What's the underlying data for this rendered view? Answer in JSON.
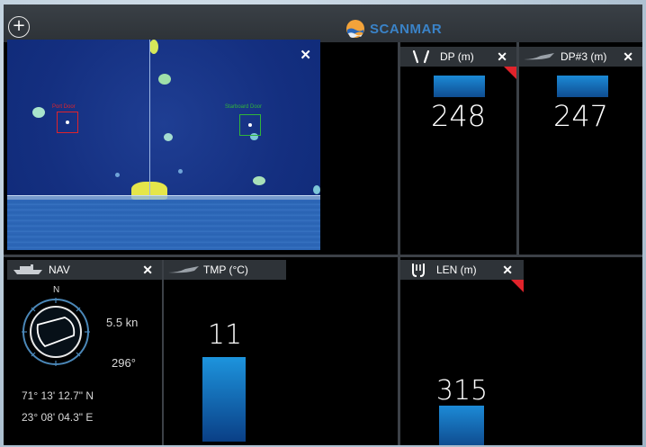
{
  "app": {
    "brand": "SCANMAR",
    "add_symbol": "+"
  },
  "colors": {
    "brand": "#3a83c8",
    "alert": "#e0232b",
    "panel_header": "#2e3338",
    "bar": "#1c8ad6"
  },
  "sonar": {
    "close_symbol": "✕",
    "targets": [
      {
        "label": "Port Door",
        "color": "#e0232b"
      },
      {
        "label": "Starboard Door",
        "color": "#31b53a"
      }
    ]
  },
  "dp": {
    "label": "DP (m)",
    "value": "248",
    "close_symbol": "✕",
    "icon": "trawl-door-icon"
  },
  "dp3": {
    "label": "DP#3 (m)",
    "value": "247",
    "close_symbol": "✕",
    "icon": "sensor-icon"
  },
  "nav": {
    "label": "NAV",
    "close_symbol": "✕",
    "icon": "ship-icon",
    "compass_north": "N",
    "speed": "5.5 kn",
    "heading": "296°",
    "latitude": "71° 13' 12.7\" N",
    "longitude": "23° 08' 04.3\" E"
  },
  "tmp": {
    "label": "TMP (°C)",
    "value": "11",
    "close_symbol": "✕",
    "icon": "sensor-icon"
  },
  "len": {
    "label": "LEN (m)",
    "value": "315",
    "close_symbol": "✕",
    "icon": "warp-length-icon"
  }
}
